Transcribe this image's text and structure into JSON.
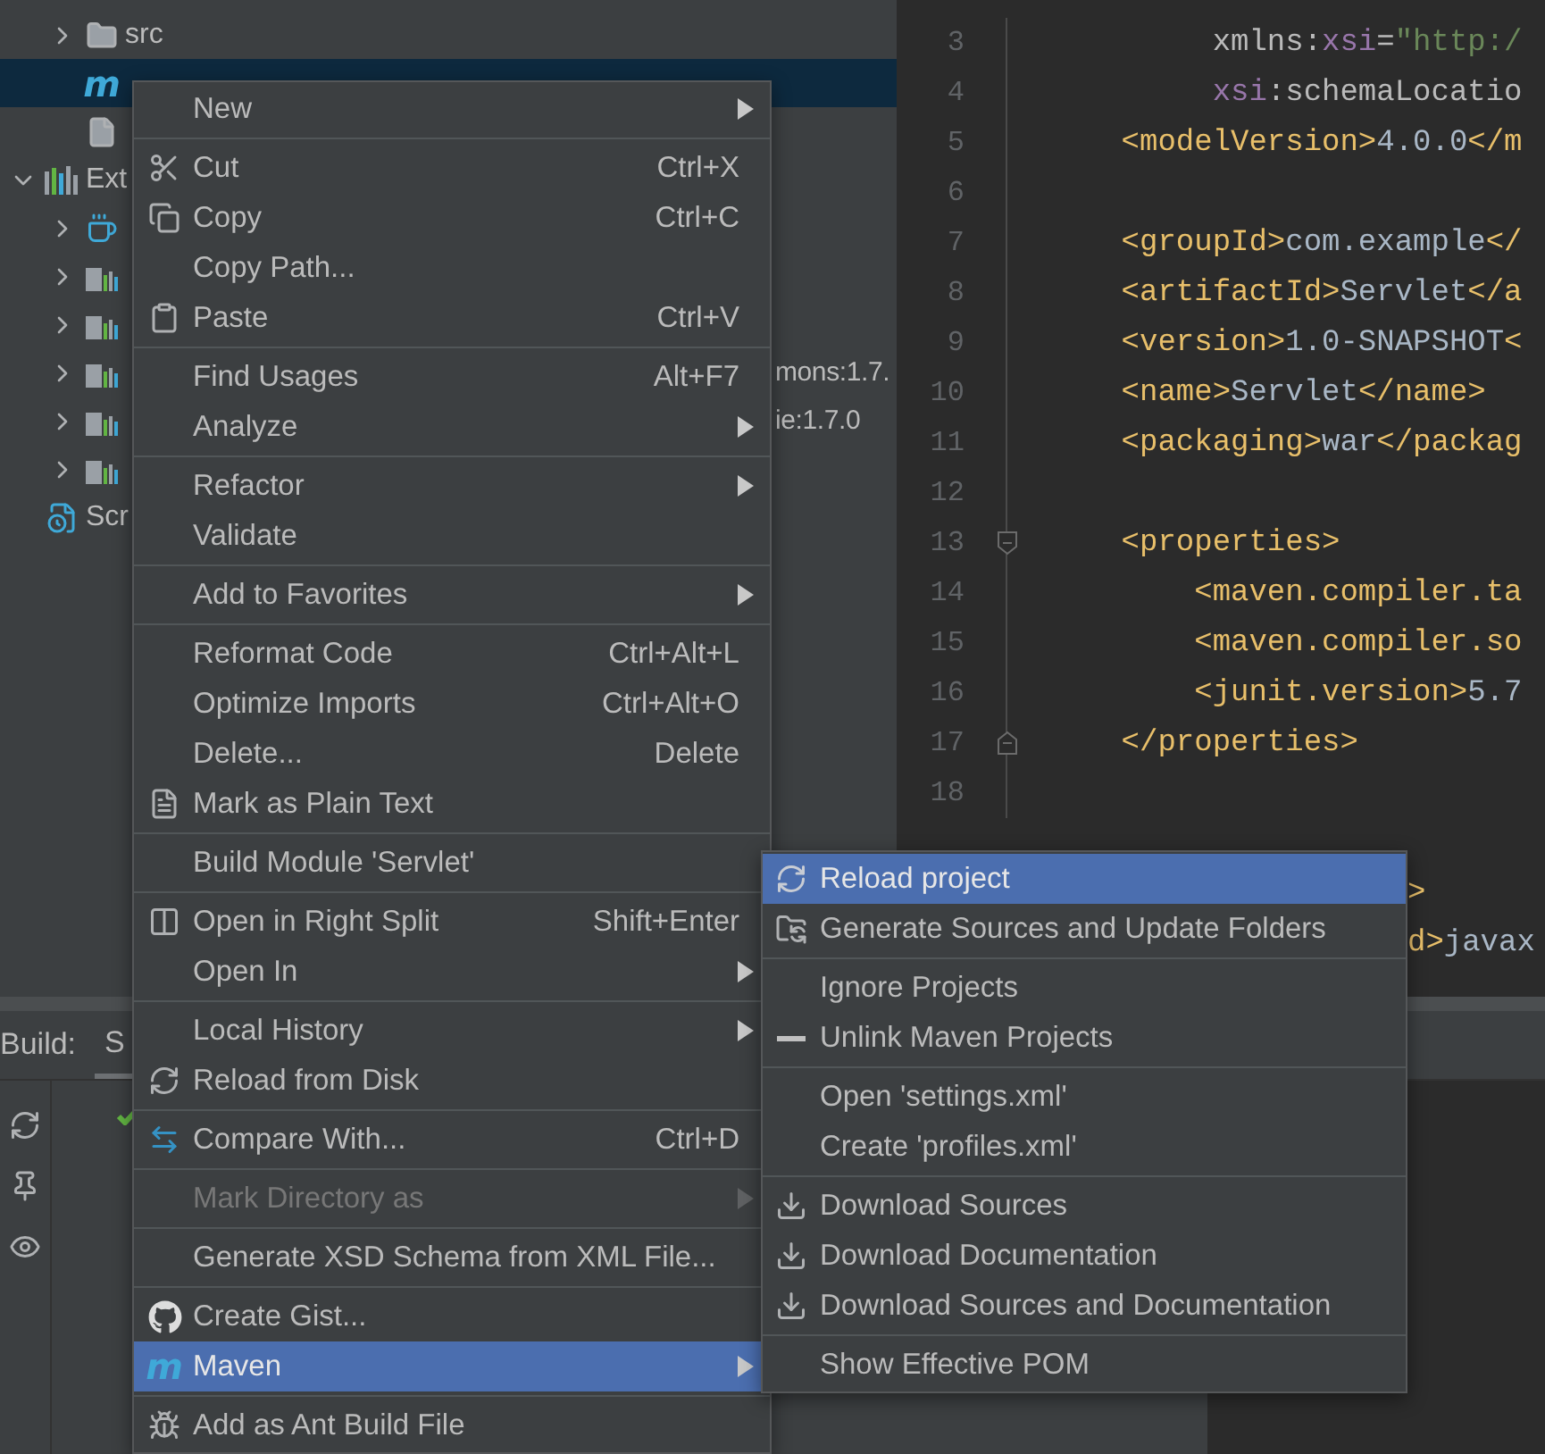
{
  "project_tree": {
    "items": [
      {
        "children": [
          {
            "label": "src",
            "expanded": false,
            "selected": false
          },
          {
            "glyph": "m",
            "selected": true
          },
          {
            "selected": false
          }
        ]
      },
      {
        "label": "Ext",
        "expanded": true,
        "selected": false,
        "children": [
          {
            "expanded": false,
            "selected": false
          },
          {
            "expanded": false,
            "selected": false
          },
          {
            "expanded": false,
            "selected": false
          },
          {
            "expanded": false,
            "selected": false,
            "trailing": "mons:1.7."
          },
          {
            "expanded": false,
            "selected": false,
            "trailing": "ie:1.7.0"
          },
          {
            "expanded": false,
            "selected": false
          }
        ]
      },
      {
        "label": "Scr",
        "selected": false
      }
    ]
  },
  "editor": {
    "lines": [
      {
        "number": "3",
        "tokens": [
          {
            "kind": "plain",
            "text": "         xmlns:"
          },
          {
            "kind": "ns",
            "text": "xsi"
          },
          {
            "kind": "plain",
            "text": "="
          },
          {
            "kind": "string",
            "text": "\"http:/"
          }
        ]
      },
      {
        "number": "4",
        "tokens": [
          {
            "kind": "ns",
            "text": "         xsi"
          },
          {
            "kind": "plain",
            "text": ":schemaLocatio"
          }
        ]
      },
      {
        "number": "5",
        "tokens": [
          {
            "kind": "tag",
            "text": "    <modelVersion>"
          },
          {
            "kind": "text",
            "text": "4.0.0"
          },
          {
            "kind": "tag",
            "text": "</m"
          }
        ]
      },
      {
        "number": "6"
      },
      {
        "number": "7",
        "tokens": [
          {
            "kind": "tag",
            "text": "    <groupId>"
          },
          {
            "kind": "text",
            "text": "com.example"
          },
          {
            "kind": "tag",
            "text": "</"
          }
        ]
      },
      {
        "number": "8",
        "tokens": [
          {
            "kind": "tag",
            "text": "    <artifactId>"
          },
          {
            "kind": "text",
            "text": "Servlet"
          },
          {
            "kind": "tag",
            "text": "</a"
          }
        ]
      },
      {
        "number": "9",
        "tokens": [
          {
            "kind": "tag",
            "text": "    <version>"
          },
          {
            "kind": "text",
            "text": "1.0-SNAPSHOT"
          },
          {
            "kind": "tag",
            "text": "<"
          }
        ]
      },
      {
        "number": "10",
        "tokens": [
          {
            "kind": "tag",
            "text": "    <name>"
          },
          {
            "kind": "text",
            "text": "Servlet"
          },
          {
            "kind": "tag",
            "text": "</name>"
          }
        ]
      },
      {
        "number": "11",
        "tokens": [
          {
            "kind": "tag",
            "text": "    <packaging>"
          },
          {
            "kind": "text",
            "text": "war"
          },
          {
            "kind": "tag",
            "text": "</packag"
          }
        ]
      },
      {
        "number": "12"
      },
      {
        "number": "13",
        "fold_start": true,
        "tokens": [
          {
            "kind": "tag",
            "text": "    <properties>"
          }
        ]
      },
      {
        "number": "14",
        "tokens": [
          {
            "kind": "tag",
            "text": "        <maven.compiler.ta"
          }
        ]
      },
      {
        "number": "15",
        "tokens": [
          {
            "kind": "tag",
            "text": "        <maven.compiler.so"
          }
        ]
      },
      {
        "number": "16",
        "tokens": [
          {
            "kind": "tag",
            "text": "        <junit.version>"
          },
          {
            "kind": "text",
            "text": "5.7"
          }
        ]
      },
      {
        "number": "17",
        "fold_end": true,
        "tokens": [
          {
            "kind": "tag",
            "text": "    </properties>"
          }
        ]
      },
      {
        "number": "18"
      },
      {
        "covered": true,
        "tokens": [
          {
            "kind": "tag",
            "text": ">"
          }
        ]
      },
      {
        "covered": true,
        "tokens": [
          {
            "kind": "tag",
            "text": "d>"
          },
          {
            "kind": "text",
            "text": "javax"
          }
        ]
      }
    ]
  },
  "build_panel": {
    "title": "Build:",
    "tabs": [
      {
        "label": "S",
        "selected": true
      }
    ]
  },
  "context_menu": {
    "items": [
      {
        "kind": "item",
        "label": "New",
        "submenu": true,
        "disabled": false,
        "selected": false
      },
      {
        "kind": "separator"
      },
      {
        "kind": "item",
        "label": "Cut",
        "shortcut": "Ctrl+X",
        "submenu": false,
        "disabled": false,
        "selected": false
      },
      {
        "kind": "item",
        "label": "Copy",
        "shortcut": "Ctrl+C",
        "submenu": false,
        "disabled": false,
        "selected": false
      },
      {
        "kind": "item",
        "label": "Copy Path...",
        "submenu": false,
        "disabled": false,
        "selected": false
      },
      {
        "kind": "item",
        "label": "Paste",
        "shortcut": "Ctrl+V",
        "submenu": false,
        "disabled": false,
        "selected": false
      },
      {
        "kind": "separator"
      },
      {
        "kind": "item",
        "label": "Find Usages",
        "shortcut": "Alt+F7",
        "submenu": false,
        "disabled": false,
        "selected": false
      },
      {
        "kind": "item",
        "label": "Analyze",
        "submenu": true,
        "disabled": false,
        "selected": false
      },
      {
        "kind": "separator"
      },
      {
        "kind": "item",
        "label": "Refactor",
        "submenu": true,
        "disabled": false,
        "selected": false
      },
      {
        "kind": "item",
        "label": "Validate",
        "submenu": false,
        "disabled": false,
        "selected": false
      },
      {
        "kind": "separator"
      },
      {
        "kind": "item",
        "label": "Add to Favorites",
        "submenu": true,
        "disabled": false,
        "selected": false
      },
      {
        "kind": "separator"
      },
      {
        "kind": "item",
        "label": "Reformat Code",
        "shortcut": "Ctrl+Alt+L",
        "submenu": false,
        "disabled": false,
        "selected": false
      },
      {
        "kind": "item",
        "label": "Optimize Imports",
        "shortcut": "Ctrl+Alt+O",
        "submenu": false,
        "disabled": false,
        "selected": false
      },
      {
        "kind": "item",
        "label": "Delete...",
        "shortcut": "Delete",
        "submenu": false,
        "disabled": false,
        "selected": false
      },
      {
        "kind": "item",
        "label": "Mark as Plain Text",
        "submenu": false,
        "disabled": false,
        "selected": false
      },
      {
        "kind": "separator"
      },
      {
        "kind": "item",
        "label": "Build Module 'Servlet'",
        "submenu": false,
        "disabled": false,
        "selected": false
      },
      {
        "kind": "separator"
      },
      {
        "kind": "item",
        "label": "Open in Right Split",
        "shortcut": "Shift+Enter",
        "submenu": false,
        "disabled": false,
        "selected": false
      },
      {
        "kind": "item",
        "label": "Open In",
        "submenu": true,
        "disabled": false,
        "selected": false
      },
      {
        "kind": "separator"
      },
      {
        "kind": "item",
        "label": "Local History",
        "submenu": true,
        "disabled": false,
        "selected": false
      },
      {
        "kind": "item",
        "label": "Reload from Disk",
        "submenu": false,
        "disabled": false,
        "selected": false
      },
      {
        "kind": "separator"
      },
      {
        "kind": "item",
        "label": "Compare With...",
        "shortcut": "Ctrl+D",
        "submenu": false,
        "disabled": false,
        "selected": false
      },
      {
        "kind": "separator"
      },
      {
        "kind": "item",
        "label": "Mark Directory as",
        "submenu": true,
        "disabled": true,
        "selected": false
      },
      {
        "kind": "separator"
      },
      {
        "kind": "item",
        "label": "Generate XSD Schema from XML File...",
        "submenu": false,
        "disabled": false,
        "selected": false
      },
      {
        "kind": "separator"
      },
      {
        "kind": "item",
        "label": "Create Gist...",
        "submenu": false,
        "disabled": false,
        "selected": false
      },
      {
        "kind": "item",
        "label": "Maven",
        "glyph": "m",
        "submenu": true,
        "disabled": false,
        "selected": true
      },
      {
        "kind": "separator"
      },
      {
        "kind": "item",
        "label": "Add as Ant Build File",
        "submenu": false,
        "disabled": false,
        "selected": false
      }
    ]
  },
  "maven_submenu": {
    "items": [
      {
        "kind": "item",
        "label": "Reload project",
        "submenu": false,
        "disabled": false,
        "selected": true
      },
      {
        "kind": "item",
        "label": "Generate Sources and Update Folders",
        "submenu": false,
        "disabled": false,
        "selected": false
      },
      {
        "kind": "separator"
      },
      {
        "kind": "item",
        "label": "Ignore Projects",
        "submenu": false,
        "disabled": false,
        "selected": false
      },
      {
        "kind": "item",
        "label": "Unlink Maven Projects",
        "submenu": false,
        "disabled": false,
        "selected": false
      },
      {
        "kind": "separator"
      },
      {
        "kind": "item",
        "label": "Open 'settings.xml'",
        "submenu": false,
        "disabled": false,
        "selected": false
      },
      {
        "kind": "item",
        "label": "Create 'profiles.xml'",
        "submenu": false,
        "disabled": false,
        "selected": false
      },
      {
        "kind": "separator"
      },
      {
        "kind": "item",
        "label": "Download Sources",
        "submenu": false,
        "disabled": false,
        "selected": false
      },
      {
        "kind": "item",
        "label": "Download Documentation",
        "submenu": false,
        "disabled": false,
        "selected": false
      },
      {
        "kind": "item",
        "label": "Download Sources and Documentation",
        "submenu": false,
        "disabled": false,
        "selected": false
      },
      {
        "kind": "separator"
      },
      {
        "kind": "item",
        "label": "Show Effective POM",
        "submenu": false,
        "disabled": false,
        "selected": false
      }
    ]
  }
}
